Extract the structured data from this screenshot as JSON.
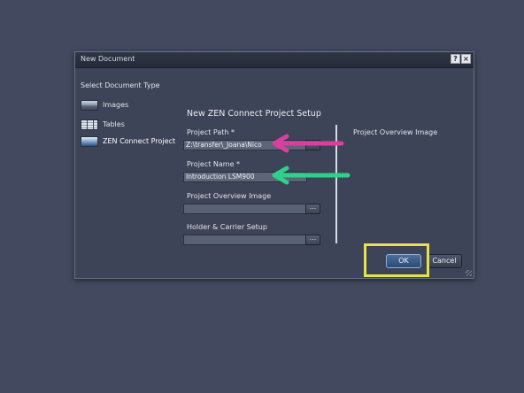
{
  "dialog": {
    "title": "New Document",
    "help_glyph": "?",
    "close_glyph": "×",
    "select_type_label": "Select Document Type",
    "types": [
      {
        "label": "Images",
        "icon": "images-icon"
      },
      {
        "label": "Tables",
        "icon": "tables-icon"
      },
      {
        "label": "ZEN Connect Project",
        "icon": "zen-connect-icon"
      }
    ],
    "section_title": "New ZEN Connect Project Setup",
    "fields": {
      "project_path": {
        "label": "Project Path *",
        "value": "Z:\\transfer\\_Joana\\Nico"
      },
      "project_name": {
        "label": "Project Name *",
        "value": "Introduction LSM900"
      },
      "overview_image": {
        "label": "Project Overview Image",
        "value": ""
      },
      "holder_setup": {
        "label": "Holder & Carrier Setup",
        "value": ""
      }
    },
    "browse_label": "...",
    "preview_label": "Project Overview Image",
    "ok_label": "OK",
    "cancel_label": "Cancel"
  },
  "annotations": {
    "arrow_path_color": "#d6409f",
    "arrow_name_color": "#2fd08a",
    "highlight_color": "#e6e24a"
  }
}
